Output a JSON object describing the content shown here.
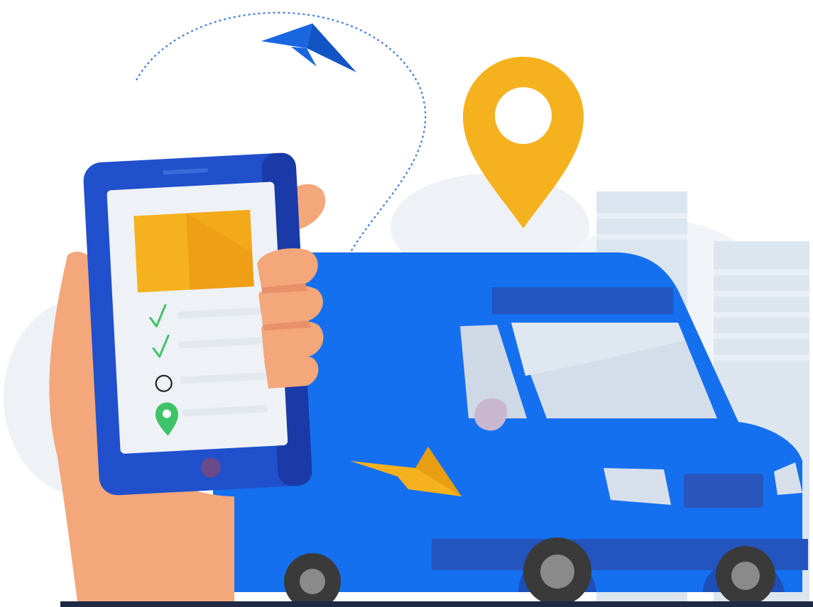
{
  "colors": {
    "background": "#ffffff",
    "van_body": "#1570f0",
    "van_dark": "#1d4fb8",
    "van_window": "#d4deea",
    "phone_frame": "#2050cc",
    "phone_dark": "#1a3aa8",
    "phone_screen": "#eef1f6",
    "pin_yellow": "#f5b21e",
    "arrow_blue": "#1a66e0",
    "arrow_yellow": "#f5b21e",
    "check_green": "#3fc36a",
    "pin_green": "#3fc36a",
    "skin": "#f4a77a",
    "skin_dark": "#e8906a",
    "building": "#dbe5ef",
    "cloud": "#eef2f7",
    "route_line": "#3f7be0",
    "ground": "#1e2a44"
  },
  "icons": {
    "location_pin": "map-pin-icon",
    "checklist_done": "check-icon",
    "checklist_pending": "circle-icon",
    "destination_pin": "map-pin-icon",
    "delivery_package": "package-icon",
    "route_arrow_start": "paper-plane-arrow-icon",
    "route_arrow_end": "arrow-icon"
  },
  "phone_checklist": {
    "items": [
      {
        "state": "done"
      },
      {
        "state": "done"
      },
      {
        "state": "pending"
      },
      {
        "state": "destination"
      }
    ]
  }
}
